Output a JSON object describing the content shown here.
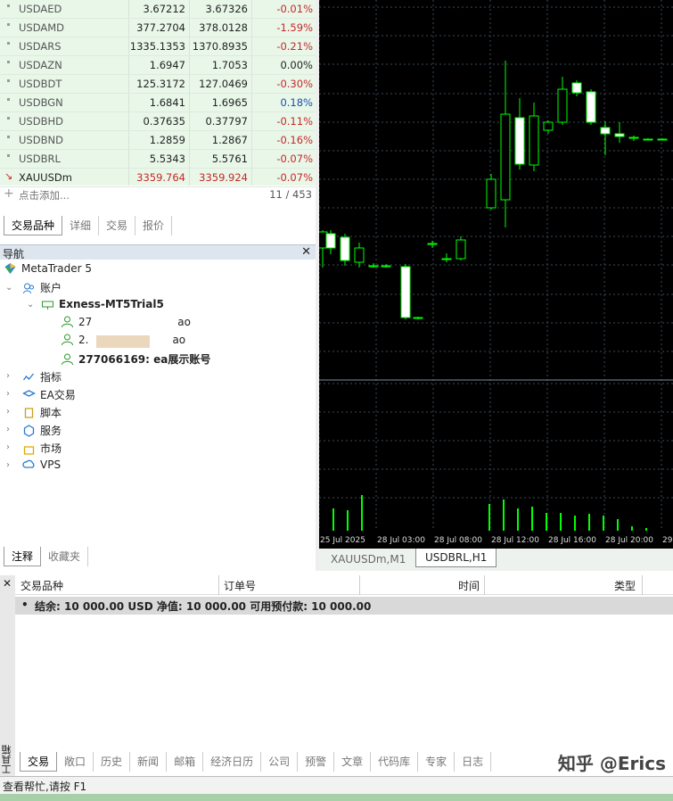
{
  "market_watch": {
    "rows": [
      {
        "symbol": "USDAED",
        "bid": "3.67212",
        "ask": "3.67326",
        "change": "-0.01%",
        "dir": "neg"
      },
      {
        "symbol": "USDAMD",
        "bid": "377.2704",
        "ask": "378.0128",
        "change": "-1.59%",
        "dir": "neg"
      },
      {
        "symbol": "USDARS",
        "bid": "1335.1353",
        "ask": "1370.8935",
        "change": "-0.21%",
        "dir": "neg"
      },
      {
        "symbol": "USDAZN",
        "bid": "1.6947",
        "ask": "1.7053",
        "change": "0.00%",
        "dir": "zero"
      },
      {
        "symbol": "USDBDT",
        "bid": "125.3172",
        "ask": "127.0469",
        "change": "-0.30%",
        "dir": "neg"
      },
      {
        "symbol": "USDBGN",
        "bid": "1.6841",
        "ask": "1.6965",
        "change": "0.18%",
        "dir": "pos"
      },
      {
        "symbol": "USDBHD",
        "bid": "0.37635",
        "ask": "0.37797",
        "change": "-0.11%",
        "dir": "neg"
      },
      {
        "symbol": "USDBND",
        "bid": "1.2859",
        "ask": "1.2867",
        "change": "-0.16%",
        "dir": "neg"
      },
      {
        "symbol": "USDBRL",
        "bid": "5.5343",
        "ask": "5.5761",
        "change": "-0.07%",
        "dir": "neg"
      },
      {
        "symbol": "XAUUSDm",
        "bid": "3359.764",
        "ask": "3359.924",
        "change": "-0.07%",
        "dir": "neg"
      }
    ],
    "add_label": "点击添加...",
    "count": "11 / 453",
    "tabs": [
      "交易品种",
      "详细",
      "交易",
      "报价"
    ]
  },
  "navigator": {
    "title": "导航",
    "close": "✕",
    "root": "MetaTrader 5",
    "accounts": "账户",
    "server": "Exness-MT5Trial5",
    "acc1_left": "27",
    "acc1_right": "ao",
    "acc2_left": "2.",
    "acc2_right": "ao",
    "acc3": "277066169: ea展示账号",
    "items": [
      "指标",
      "EA交易",
      "脚本",
      "服务",
      "市场",
      "VPS"
    ],
    "tabs": [
      "注释",
      "收藏夹"
    ]
  },
  "chart": {
    "time_labels": [
      "25 Jul 2025",
      "28 Jul 03:00",
      "28 Jul 08:00",
      "28 Jul 12:00",
      "28 Jul 16:00",
      "28 Jul 20:00",
      "29"
    ],
    "tabs": [
      "XAUUSDm,M1",
      "USDBRL,H1"
    ],
    "colors": {
      "bull": "#00ff00",
      "bear": "#00ff00",
      "bg": "#000000",
      "grid": "#3a4a5a",
      "vol": "#00ff00"
    }
  },
  "toolbox": {
    "side_title": "工具箱",
    "close": "✕",
    "columns": [
      "交易品种",
      "订单号",
      "时间",
      "类型"
    ],
    "balance": "结余: 10 000.00 USD  净值: 10 000.00  可用预付款: 10 000.00",
    "tabs": [
      "交易",
      "敞口",
      "历史",
      "新闻",
      "邮箱",
      "经济日历",
      "公司",
      "预警",
      "文章",
      "代码库",
      "专家",
      "日志"
    ]
  },
  "status": "查看帮忙,请按 F1",
  "watermark": "知乎 @Erics"
}
